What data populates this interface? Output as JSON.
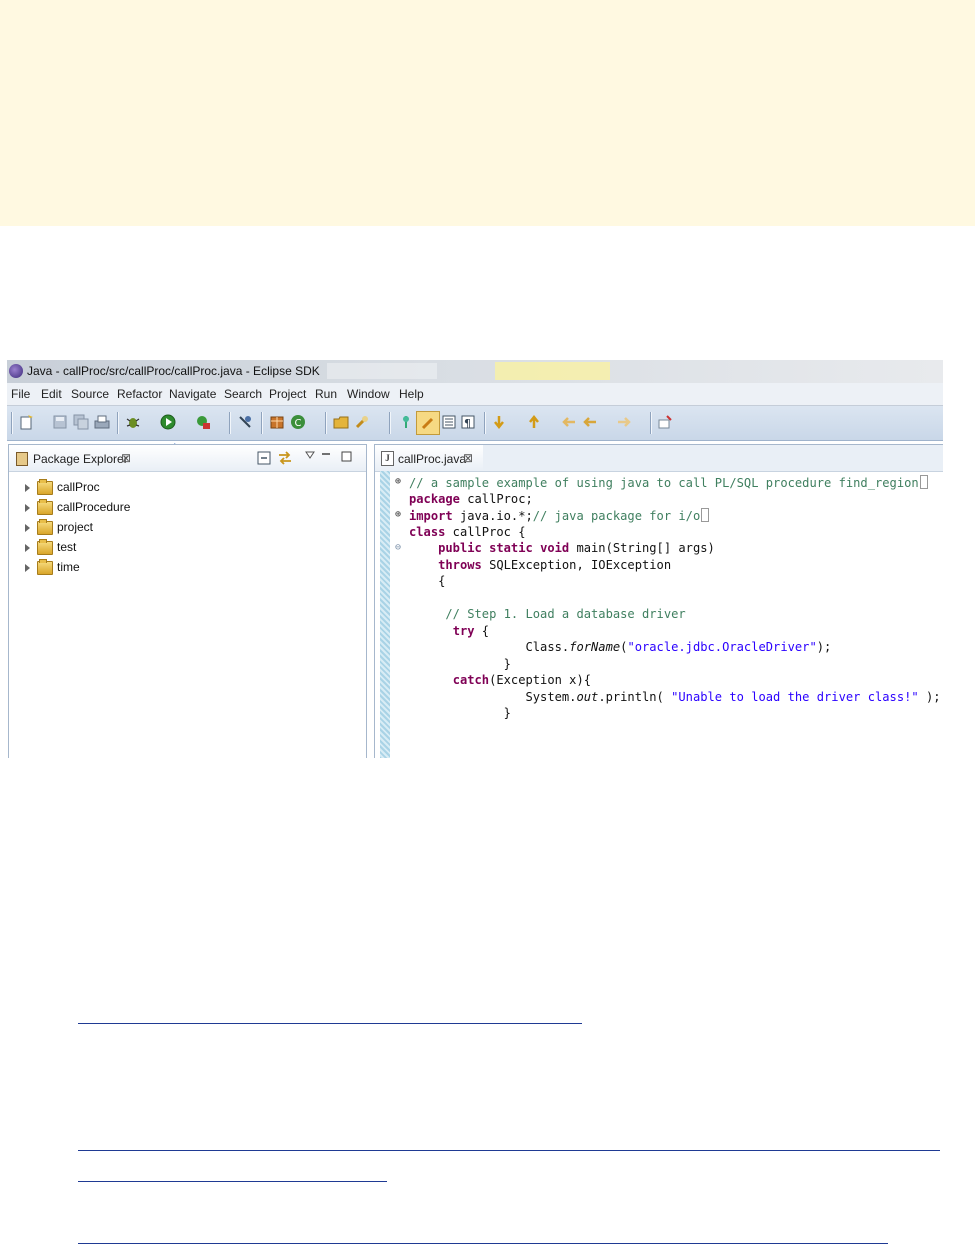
{
  "window": {
    "title": "Java - callProc/src/callProc/callProc.java - Eclipse SDK"
  },
  "menu": [
    "File",
    "Edit",
    "Source",
    "Refactor",
    "Navigate",
    "Search",
    "Project",
    "Run",
    "Window",
    "Help"
  ],
  "package_explorer": {
    "title": "Package Explorer",
    "projects": [
      "callProc",
      "callProcedure",
      "project",
      "test",
      "time"
    ]
  },
  "editor": {
    "tab_title": "callProc.java",
    "lines": [
      {
        "t": "// a sample example of using java to call PL/SQL procedure find_region",
        "kind": "comment-fold"
      },
      {
        "t": "package callProc;",
        "kind": "package"
      },
      {
        "t": "import java.io.*;// java package for i/o",
        "kind": "import-fold"
      },
      {
        "t": "class callProc {",
        "kind": "class"
      },
      {
        "t": "    public static void main(String[] args)",
        "kind": "main"
      },
      {
        "t": "    throws SQLException, IOException",
        "kind": "throws"
      },
      {
        "t": "    {",
        "kind": "plain"
      },
      {
        "t": "",
        "kind": "plain"
      },
      {
        "t": "     // Step 1. Load a database driver",
        "kind": "comment"
      },
      {
        "t": "      try {",
        "kind": "try"
      },
      {
        "t": "                Class.forName(\"oracle.jdbc.OracleDriver\");",
        "kind": "forname"
      },
      {
        "t": "             }",
        "kind": "plain"
      },
      {
        "t": "      catch(Exception x){",
        "kind": "catch"
      },
      {
        "t": "                System.out.println( \"Unable to load the driver class!\" );",
        "kind": "println"
      },
      {
        "t": "             }",
        "kind": "plain"
      }
    ]
  },
  "colors": {
    "page_banner": "#fff9e1",
    "keyword": "#7f0055",
    "comment": "#3f7f5f",
    "string": "#2a00ff",
    "link": "#1f3a93"
  }
}
